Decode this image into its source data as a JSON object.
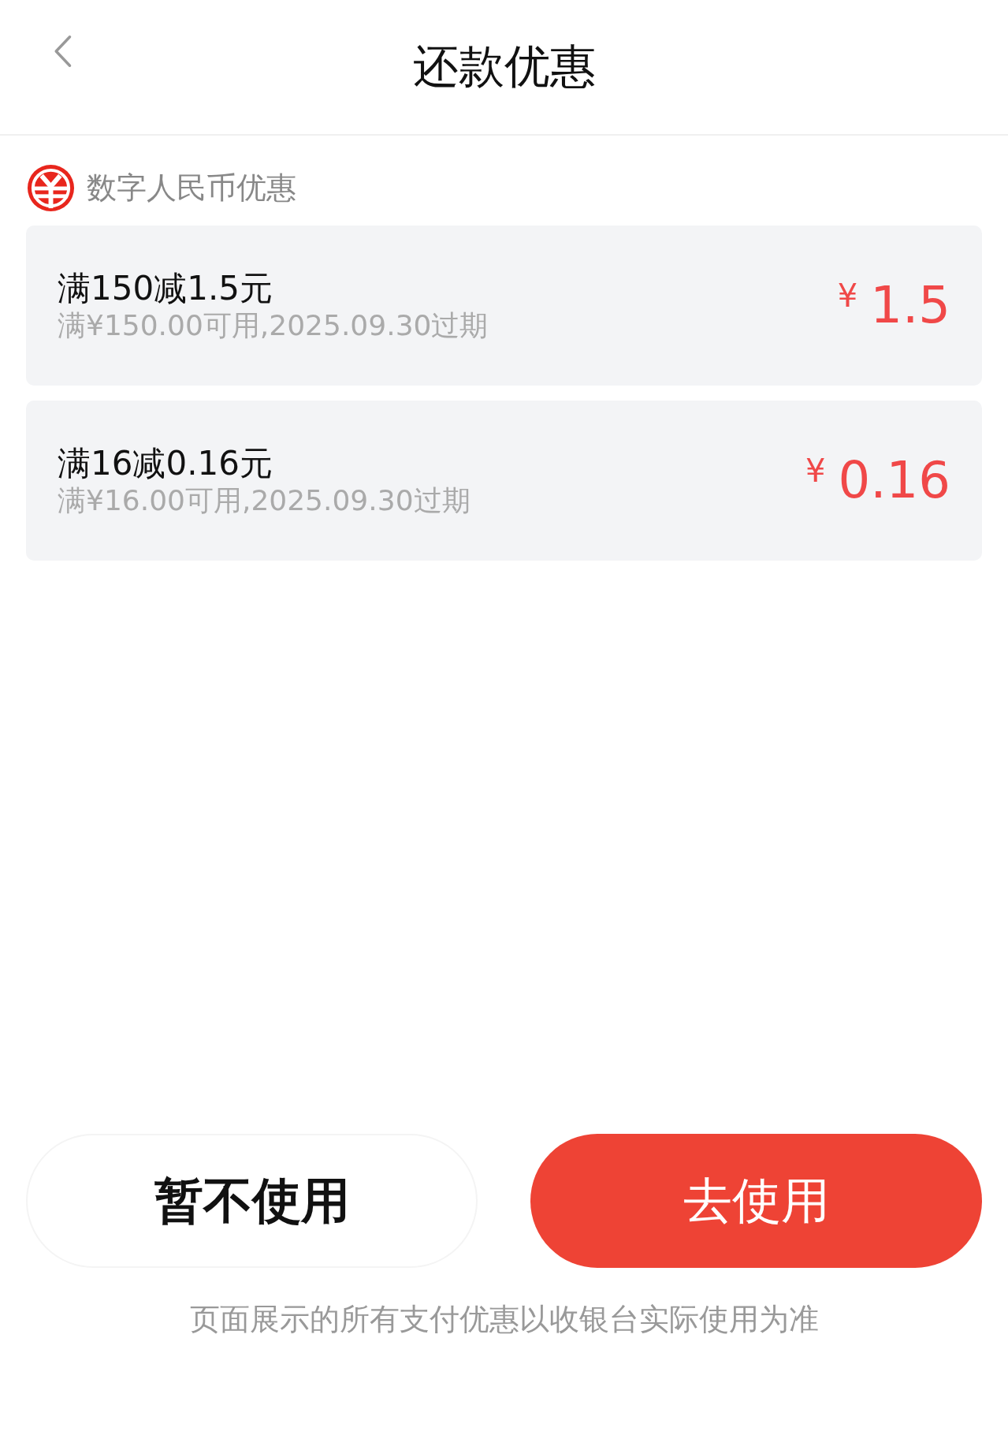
{
  "header": {
    "title": "还款优惠"
  },
  "section": {
    "label": "数字人民币优惠"
  },
  "coupons": [
    {
      "title": "满150减1.5元",
      "condition": "满¥150.00可用,2025.09.30过期",
      "currency": "¥",
      "amount": "1.5"
    },
    {
      "title": "满16减0.16元",
      "condition": "满¥16.00可用,2025.09.30过期",
      "currency": "¥",
      "amount": "0.16"
    }
  ],
  "buttons": [
    {
      "kind": "secondary",
      "label": "暂不使用"
    },
    {
      "kind": "primary",
      "label": "去使用"
    }
  ],
  "footer_note": "页面展示的所有支付优惠以收银台实际使用为准"
}
